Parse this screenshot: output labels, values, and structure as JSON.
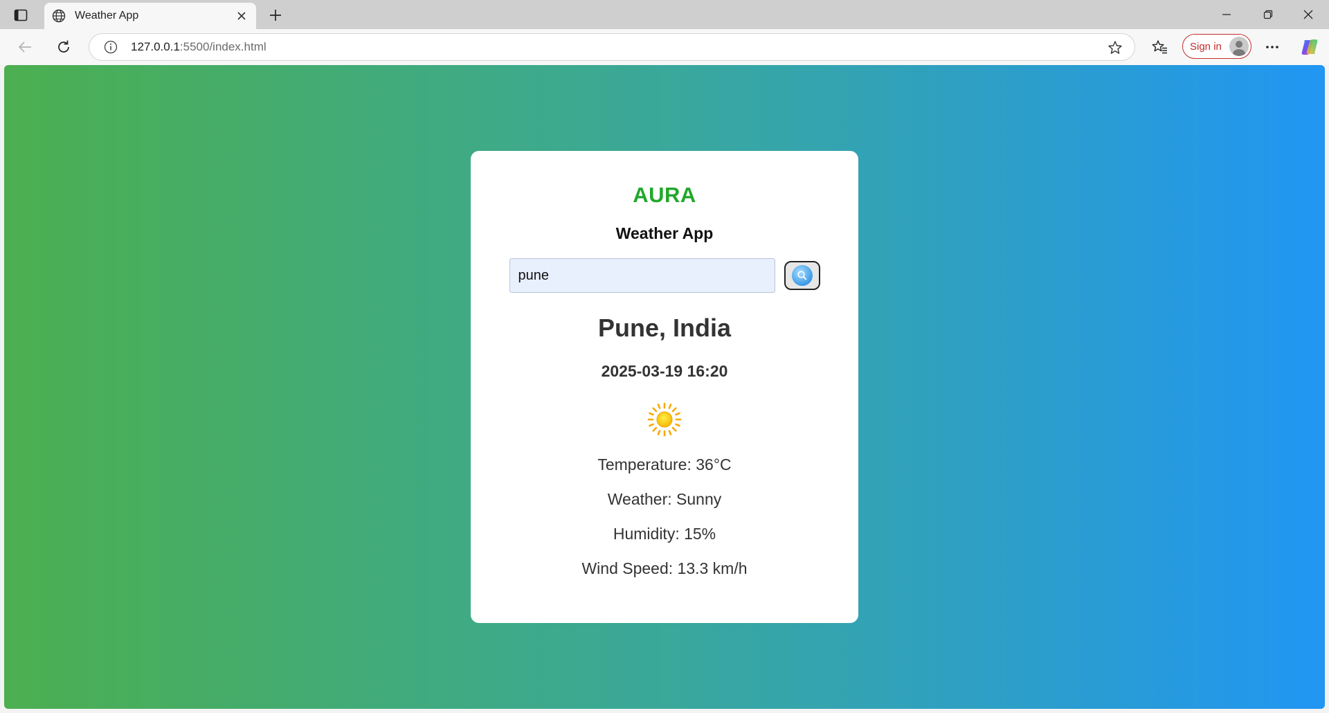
{
  "browser": {
    "tab_title": "Weather App",
    "url_host": "127.0.0.1",
    "url_path": ":5500/index.html",
    "signin_label": "Sign in"
  },
  "app": {
    "brand": "AURA",
    "title": "Weather App",
    "search": {
      "value": "pune",
      "placeholder": ""
    },
    "location": "Pune, India",
    "datetime": "2025-03-19 16:20",
    "weather_icon": "sun-icon",
    "temperature": "Temperature: 36°C",
    "condition": "Weather: Sunny",
    "humidity": "Humidity: 15%",
    "wind": "Wind Speed: 13.3 km/h"
  },
  "colors": {
    "gradient_start": "#4caf50",
    "gradient_end": "#2196f3",
    "brand": "#22a82a",
    "signin": "#c42b2b"
  }
}
